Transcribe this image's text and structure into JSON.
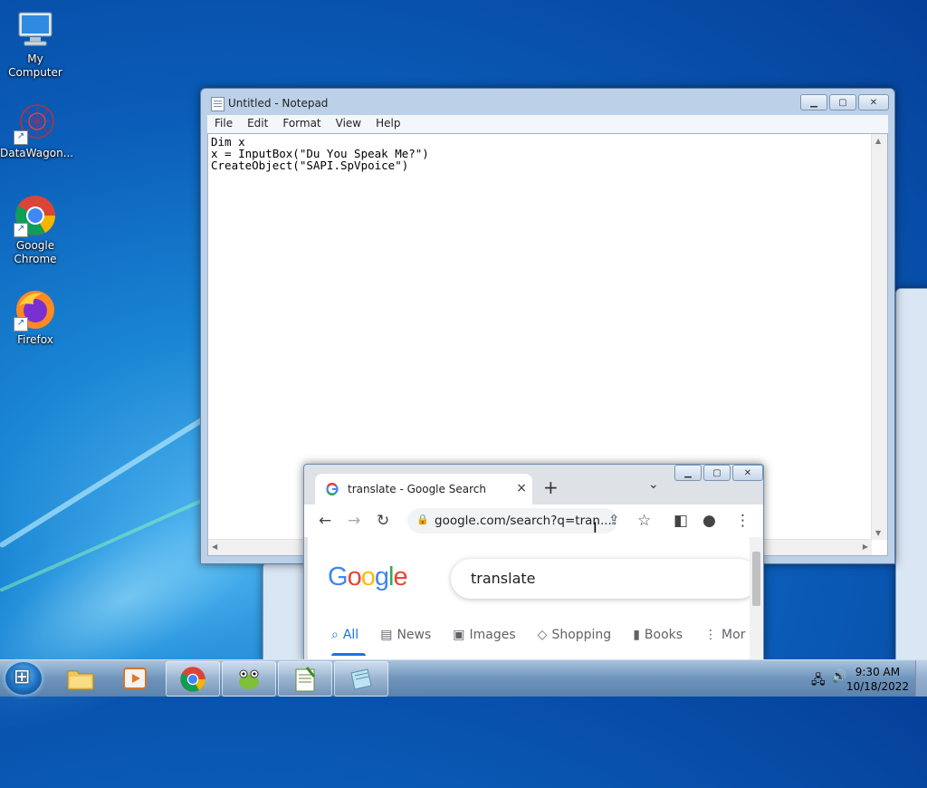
{
  "desktop": {
    "icons": [
      {
        "label": "My Computer",
        "icon": "computer-icon"
      },
      {
        "label": "DataWagon...",
        "icon": "datawagon-icon"
      },
      {
        "label": "Google Chrome",
        "icon": "chrome-icon"
      },
      {
        "label": "Firefox",
        "icon": "firefox-icon"
      }
    ]
  },
  "notepad": {
    "title": "Untitled - Notepad",
    "menu": [
      "File",
      "Edit",
      "Format",
      "View",
      "Help"
    ],
    "content": "Dim x\nx = InputBox(\"Du You Speak Me?\")\nCreateObject(\"SAPI.SpVpoice\")"
  },
  "chrome": {
    "tab_title": "translate - Google Search",
    "tab_close": "×",
    "new_tab": "+",
    "url": "google.com/search?q=tran...",
    "logo": "Google",
    "search_query": "translate",
    "search_tabs": [
      {
        "label": "All",
        "icon": "search-icon",
        "active": true
      },
      {
        "label": "News",
        "icon": "news-icon"
      },
      {
        "label": "Images",
        "icon": "image-icon"
      },
      {
        "label": "Shopping",
        "icon": "tag-icon"
      },
      {
        "label": "Books",
        "icon": "book-icon"
      },
      {
        "label": "Mor",
        "icon": "more-vert-icon"
      }
    ]
  },
  "taskbar": {
    "time": "9:30 AM",
    "date": "10/18/2022",
    "apps": [
      "explorer",
      "media-player",
      "chrome",
      "datawagon",
      "notepad-plus",
      "notepad"
    ]
  },
  "colors": {
    "google_blue": "#4285F4",
    "google_red": "#EA4335",
    "google_yellow": "#FBBC05",
    "google_green": "#34A853",
    "active_tab": "#1a73e8"
  }
}
